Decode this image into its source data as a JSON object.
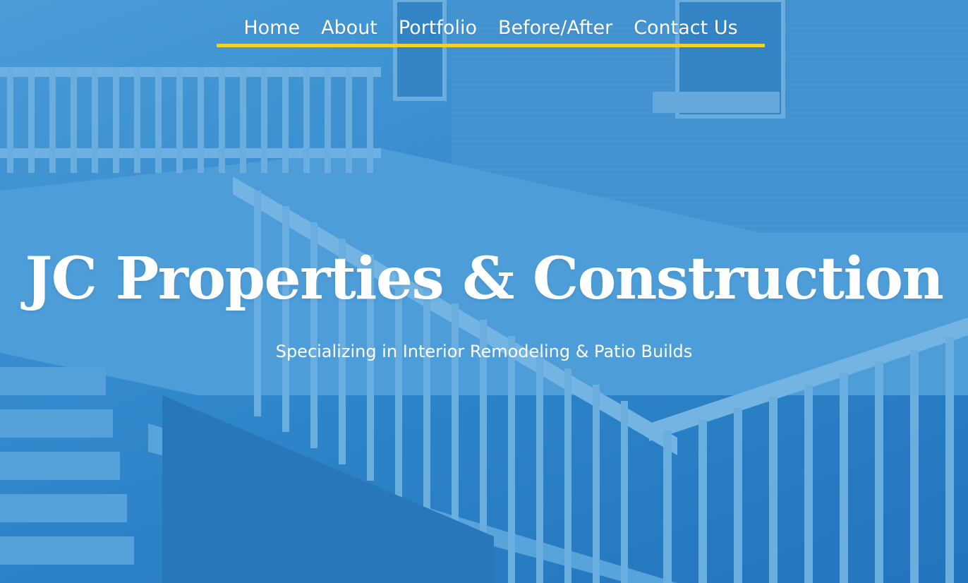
{
  "nav": {
    "items": [
      {
        "label": "Home"
      },
      {
        "label": "About"
      },
      {
        "label": "Portfolio"
      },
      {
        "label": "Before/After"
      },
      {
        "label": "Contact Us"
      }
    ],
    "underline_color": "#f6cf2b"
  },
  "hero": {
    "title": "JC Properties & Construction",
    "subtitle": "Specializing in Interior Remodeling & Patio Builds",
    "overlay_color": "#2e86cc"
  }
}
